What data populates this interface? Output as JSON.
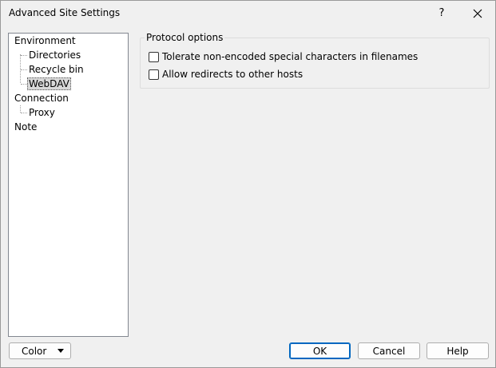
{
  "window": {
    "title": "Advanced Site Settings",
    "help_label": "?",
    "close_icon": "close-icon"
  },
  "tree": {
    "items": [
      {
        "label": "Environment",
        "level": 0,
        "selected": false
      },
      {
        "label": "Directories",
        "level": 1,
        "selected": false
      },
      {
        "label": "Recycle bin",
        "level": 1,
        "selected": false
      },
      {
        "label": "WebDAV",
        "level": 1,
        "selected": true
      },
      {
        "label": "Connection",
        "level": 0,
        "selected": false
      },
      {
        "label": "Proxy",
        "level": 1,
        "selected": false
      },
      {
        "label": "Note",
        "level": 0,
        "selected": false
      }
    ]
  },
  "protocol_options": {
    "legend": "Protocol options",
    "options": [
      {
        "label": "Tolerate non-encoded special characters in filenames",
        "checked": false
      },
      {
        "label": "Allow redirects to other hosts",
        "checked": false
      }
    ]
  },
  "buttons": {
    "color_label": "Color",
    "ok_label": "OK",
    "cancel_label": "Cancel",
    "help_label": "Help"
  },
  "colors": {
    "default_button_border": "#0067c0",
    "window_bg": "#f0f0f0"
  }
}
